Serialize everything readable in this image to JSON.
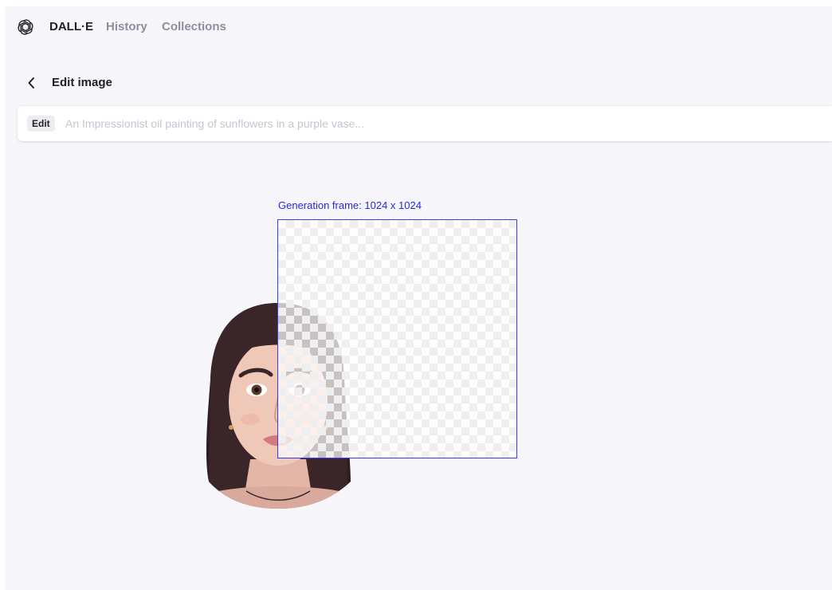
{
  "nav": {
    "logo_icon": "openai-logo-icon",
    "brand": "DALL·E",
    "history": "History",
    "collections": "Collections"
  },
  "header": {
    "back_icon": "chevron-left-icon",
    "title": "Edit image"
  },
  "prompt": {
    "badge": "Edit",
    "placeholder": "An Impressionist oil painting of sunflowers in a purple vase...",
    "value": ""
  },
  "canvas": {
    "frame_label": "Generation frame: 1024 x 1024",
    "frame_color": "#3b3bf5",
    "label_color": "#2626e0"
  },
  "colors": {
    "background": "#f7f7fb",
    "text": "#202123",
    "muted": "#8e8ea0"
  }
}
